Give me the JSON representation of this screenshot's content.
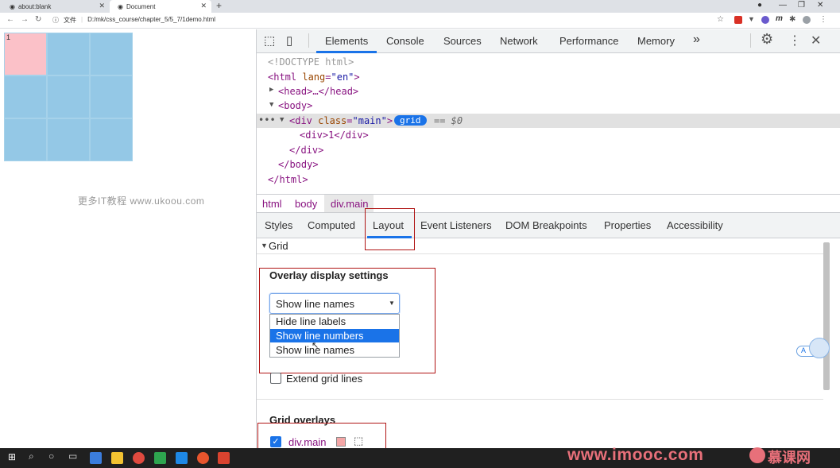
{
  "browser": {
    "tabs": [
      {
        "title": "about:blank"
      },
      {
        "title": "Document"
      }
    ],
    "address": {
      "file_label": "文件",
      "url": "D:/mk/css_course/chapter_5/5_7/1demo.html"
    }
  },
  "page": {
    "first_cell_label": "1",
    "watermark": "更多IT教程 www.ukoou.com"
  },
  "devtools": {
    "main_tabs": [
      "Elements",
      "Console",
      "Sources",
      "Network",
      "Performance",
      "Memory"
    ],
    "more_tabs_label": "»",
    "dom": {
      "doctype": "<!DOCTYPE html>",
      "html_open": "<html",
      "lang_attr": "lang",
      "lang_value": "\"en\"",
      "head": "<head>…</head>",
      "body_open": "<body>",
      "div_open": "<div",
      "class_attr": "class",
      "class_value": "\"main\"",
      "grid_badge": "grid",
      "selected_marker": "== $0",
      "child": "<div>1</div>",
      "div_close": "</div>",
      "body_close": "</body>",
      "html_close": "</html>"
    },
    "breadcrumbs": [
      "html",
      "body",
      "div.main"
    ],
    "sub_tabs": [
      "Styles",
      "Computed",
      "Layout",
      "Event Listeners",
      "DOM Breakpoints",
      "Properties",
      "Accessibility"
    ],
    "layout": {
      "grid_section": "Grid",
      "overlay_heading": "Overlay display settings",
      "select_value": "Show line names",
      "options": [
        "Hide line labels",
        "Show line numbers",
        "Show line names"
      ],
      "selected_option_index": 1,
      "extend_grid_lines_label": "Extend grid lines",
      "grid_overlays_heading": "Grid overlays",
      "overlay_item_label": "div.main",
      "overlay_color": "#f4a6a6"
    }
  },
  "watermark_brand": {
    "site": "www.imooc.com",
    "cn": "慕课网"
  },
  "colors": {
    "accent": "#1a73e8",
    "grid_cell": "#94c8e6",
    "first_cell": "#fbc1c8",
    "highlight_box": "#b01414"
  }
}
